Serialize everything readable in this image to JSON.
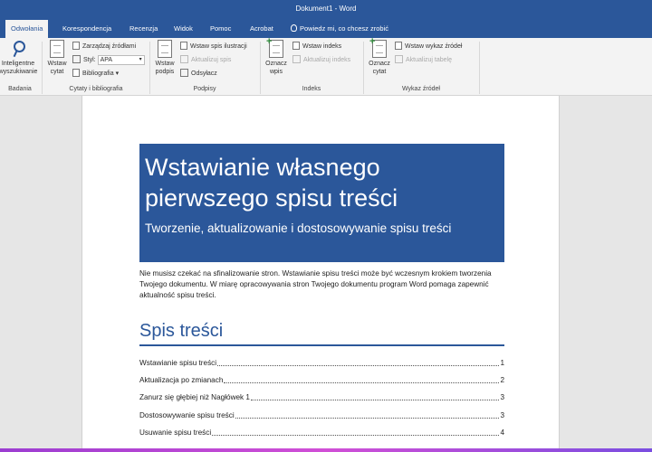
{
  "window": {
    "title": "Dokument1 - Word"
  },
  "tabs": [
    {
      "label": "Odwołania",
      "active": true
    },
    {
      "label": "Korespondencja",
      "active": false
    },
    {
      "label": "Recenzja",
      "active": false
    },
    {
      "label": "Widok",
      "active": false
    },
    {
      "label": "Pomoc",
      "active": false
    },
    {
      "label": "Acrobat",
      "active": false
    }
  ],
  "tell_me": {
    "label": "Powiedz mi, co chcesz zrobić",
    "icon": "lightbulb-icon"
  },
  "ribbon": {
    "badania": {
      "smart_lookup_line1": "Inteligentne",
      "smart_lookup_line2": "wyszukiwanie",
      "group_label": "Badania"
    },
    "cytaty": {
      "insert_citation_line1": "Wstaw",
      "insert_citation_line2": "cytat",
      "manage_sources": "Zarządzaj źródłami",
      "style_label": "Styl:",
      "style_value": "APA",
      "bibliography": "Bibliografia",
      "group_label": "Cytaty i bibliografia"
    },
    "podpisy": {
      "insert_caption_line1": "Wstaw",
      "insert_caption_line2": "podpis",
      "insert_table_of_figures": "Wstaw spis ilustracji",
      "update_table": "Aktualizuj spis",
      "cross_reference": "Odsyłacz",
      "group_label": "Podpisy"
    },
    "indeks": {
      "mark_entry_line1": "Oznacz",
      "mark_entry_line2": "wpis",
      "insert_index": "Wstaw indeks",
      "update_index": "Aktualizuj indeks",
      "group_label": "Indeks"
    },
    "wykaz": {
      "mark_citation_line1": "Oznacz",
      "mark_citation_line2": "cytat",
      "insert_table_of_authorities": "Wstaw wykaz źródeł",
      "update_table": "Aktualizuj tabelę",
      "group_label": "Wykaz źródeł"
    }
  },
  "document": {
    "cover_title": "Wstawianie własnego pierwszego spisu treści",
    "cover_subtitle": "Tworzenie, aktualizowanie i dostosowywanie spisu treści",
    "intro": "Nie musisz czekać na sfinalizowanie stron. Wstawianie spisu treści może być wczesnym krokiem tworzenia Twojego dokumentu. W miarę opracowywania stron Twojego dokumentu program Word pomaga zapewnić aktualność spisu treści.",
    "toc_heading": "Spis treści",
    "toc_entries": [
      {
        "label": "Wstawianie spisu treści",
        "page": "1"
      },
      {
        "label": "Aktualizacja po zmianach",
        "page": "2"
      },
      {
        "label": "Zanurz się głębiej niż Nagłówek 1",
        "page": "3"
      },
      {
        "label": "Dostosowywanie spisu treści",
        "page": "3"
      },
      {
        "label": "Usuwanie spisu treści",
        "page": "4"
      }
    ]
  },
  "colors": {
    "accent": "#2b579a",
    "ribbon_bg": "#f3f3f3",
    "canvas_bg": "#e6e6e6"
  }
}
